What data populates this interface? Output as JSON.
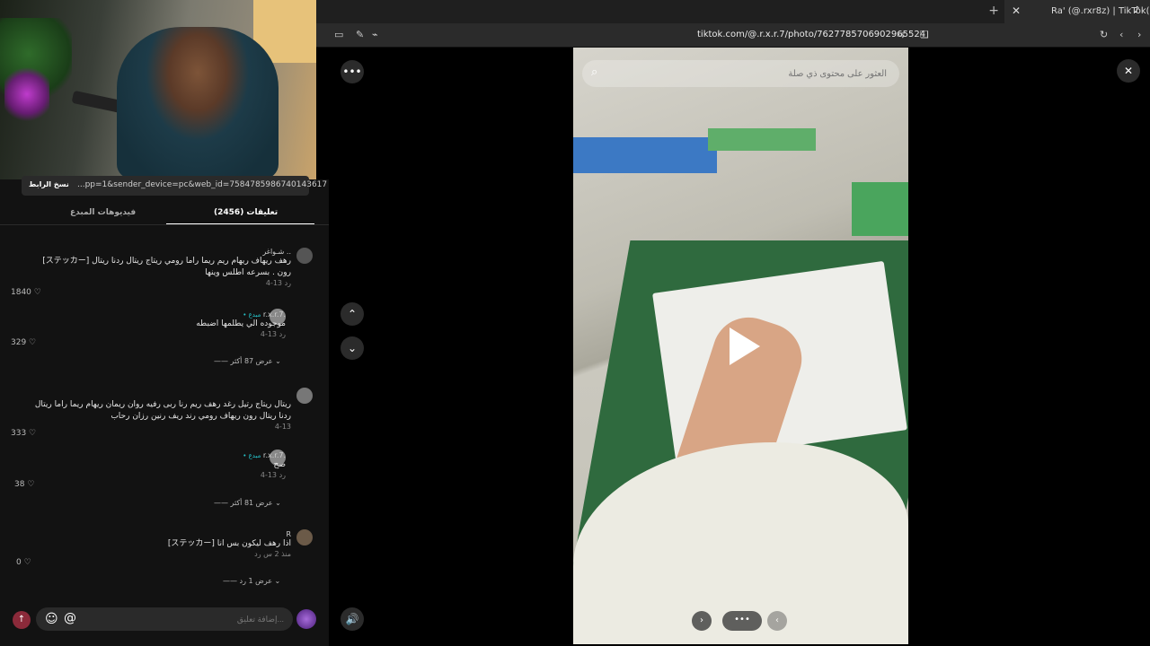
{
  "browser": {
    "tab_title": "Ra' (@.rxr8z) | TikTok(1)",
    "url": "tiktok.com/@.r.x.r.7/photo/7627785706902965524",
    "new_tab": "+",
    "close": "✕"
  },
  "panel": {
    "copy_link": "نسخ الرابط",
    "link_text": "...pp=1&sender_device=pc&web_id=7584785986740143617",
    "tabs": [
      {
        "label": "فيديوهات المبدع"
      },
      {
        "label": "تعليقات (2456)"
      }
    ],
    "comments": [
      {
        "user": "شـواغر ..",
        "lines": [
          "[ステッカー] رهف ريهاف ريهام ريم ريما راما رومي ريتاج ريتال ردنا ريتال",
          "رون . بسرعه اطلس وينها"
        ],
        "meta": "4-13   رد",
        "likes": "1840 ♡"
      },
      {
        "user": "r.x.r.7.",
        "creator": "• مبدع",
        "lines": [
          "موجوده الي يطلمها اضبطه"
        ],
        "meta": "4-13   رد",
        "likes": "329 ♡",
        "more": "—— عرض 87 أكثر ⌄"
      },
      {
        "user": "",
        "lines": [
          "ريتال ريتاج رتيل رغد رهف ريم رنا ربى رفيه روان ريمان ريهام ريما راما ريتال",
          "ردنا ريتال رون ريهاف رومي رند ريف رنين رزان رحاب"
        ],
        "meta": "4-13",
        "likes": "333 ♡"
      },
      {
        "user": "r.x.r.7.",
        "creator": "• مبدع",
        "lines": [
          "صح"
        ],
        "meta": "4-13   رد",
        "likes": "38 ♡",
        "more": "—— عرض 81 أكثر ⌄"
      },
      {
        "user": "R",
        "lines": [
          "[ステッカー] اذا رهف ليكون بس انا"
        ],
        "meta": "منذ 2 س   رد",
        "likes": "0 ♡",
        "more": "—— عرض 1 رد ⌄"
      }
    ],
    "composer_placeholder": "إضافة تعليق...",
    "send": "↑",
    "emoji": "☺",
    "at": "@"
  },
  "viewer": {
    "search_placeholder": "العثور على محتوى ذي صلة",
    "more_dots": "•••",
    "close": "✕",
    "up": "⌃",
    "down": "⌄",
    "sound": "🔊",
    "pager_prev": "‹",
    "pager_next": "›",
    "pager_dots": "•••"
  }
}
